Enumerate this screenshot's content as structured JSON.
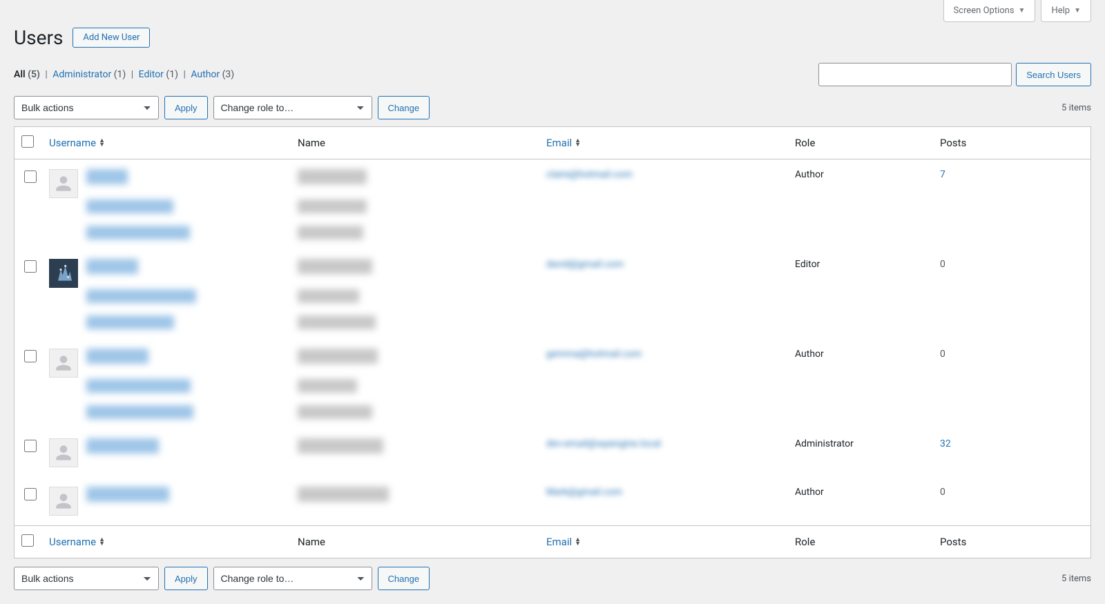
{
  "top_tabs": {
    "screen_options": "Screen Options",
    "help": "Help"
  },
  "page": {
    "title": "Users",
    "add_new": "Add New User"
  },
  "filters": {
    "all": {
      "label": "All",
      "count": "(5)"
    },
    "administrator": {
      "label": "Administrator",
      "count": "(1)"
    },
    "editor": {
      "label": "Editor",
      "count": "(1)"
    },
    "author": {
      "label": "Author",
      "count": "(3)"
    }
  },
  "search": {
    "button": "Search Users"
  },
  "bulk": {
    "actions_label": "Bulk actions",
    "apply": "Apply",
    "change_role_label": "Change role to…",
    "change": "Change"
  },
  "pagination": {
    "items": "5 items"
  },
  "columns": {
    "username": "Username",
    "name": "Name",
    "email": "Email",
    "role": "Role",
    "posts": "Posts"
  },
  "rows": [
    {
      "email": "claire@hotmail.com",
      "role": "Author",
      "posts": "7",
      "posts_link": true,
      "avatar": "default",
      "extras": 2
    },
    {
      "email": "david@gmail.com",
      "role": "Editor",
      "posts": "0",
      "posts_link": false,
      "avatar": "blue",
      "extras": 2
    },
    {
      "email": "gemma@hotmail.com",
      "role": "Author",
      "posts": "0",
      "posts_link": false,
      "avatar": "default",
      "extras": 2
    },
    {
      "email": "dev-email@wpengine.local",
      "role": "Administrator",
      "posts": "32",
      "posts_link": true,
      "avatar": "default",
      "extras": 0
    },
    {
      "email": "Mark@gmail.com",
      "role": "Author",
      "posts": "0",
      "posts_link": false,
      "avatar": "default",
      "extras": 0
    }
  ]
}
